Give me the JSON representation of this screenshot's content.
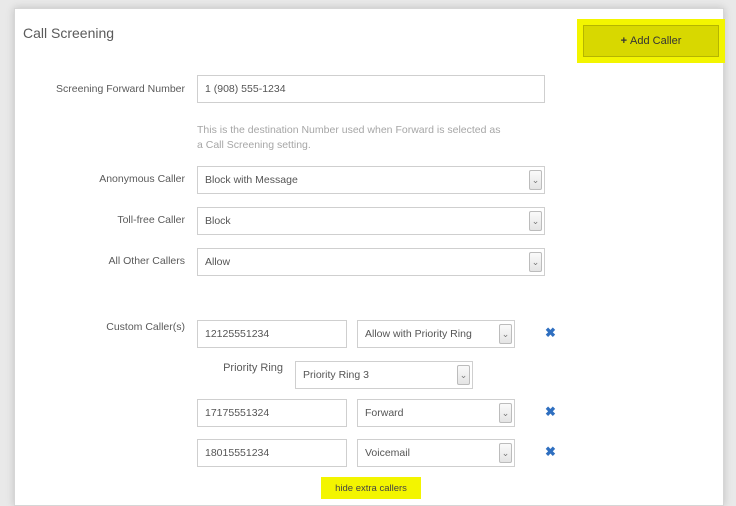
{
  "page": {
    "title": "Call Screening"
  },
  "toolbar": {
    "add_caller_label": "Add Caller",
    "add_icon": "+"
  },
  "screening_forward": {
    "label": "Screening Forward Number",
    "value": "1 (908) 555-1234",
    "help": [
      "This is the destination Number used when Forward is selected as",
      "a Call Screening setting."
    ]
  },
  "anonymous": {
    "label": "Anonymous Caller",
    "value": "Block with Message"
  },
  "toll_free": {
    "label": "Toll-free Caller",
    "value": "Block"
  },
  "all_other": {
    "label": "All Other Callers",
    "value": "Allow"
  },
  "custom": {
    "label": "Custom Caller(s)",
    "rows": [
      {
        "number": "12125551234",
        "action": "Allow with Priority Ring"
      },
      {
        "number": "17175551324",
        "action": "Forward"
      },
      {
        "number": "18015551234",
        "action": "Voicemail"
      }
    ],
    "priority_ring": {
      "label": "Priority Ring",
      "value": "Priority Ring 3"
    },
    "remove_icon": "✖",
    "hide_extra_label": "hide extra callers"
  },
  "colors": {
    "highlight": "#f3f500",
    "remove": "#2f6fc0"
  }
}
